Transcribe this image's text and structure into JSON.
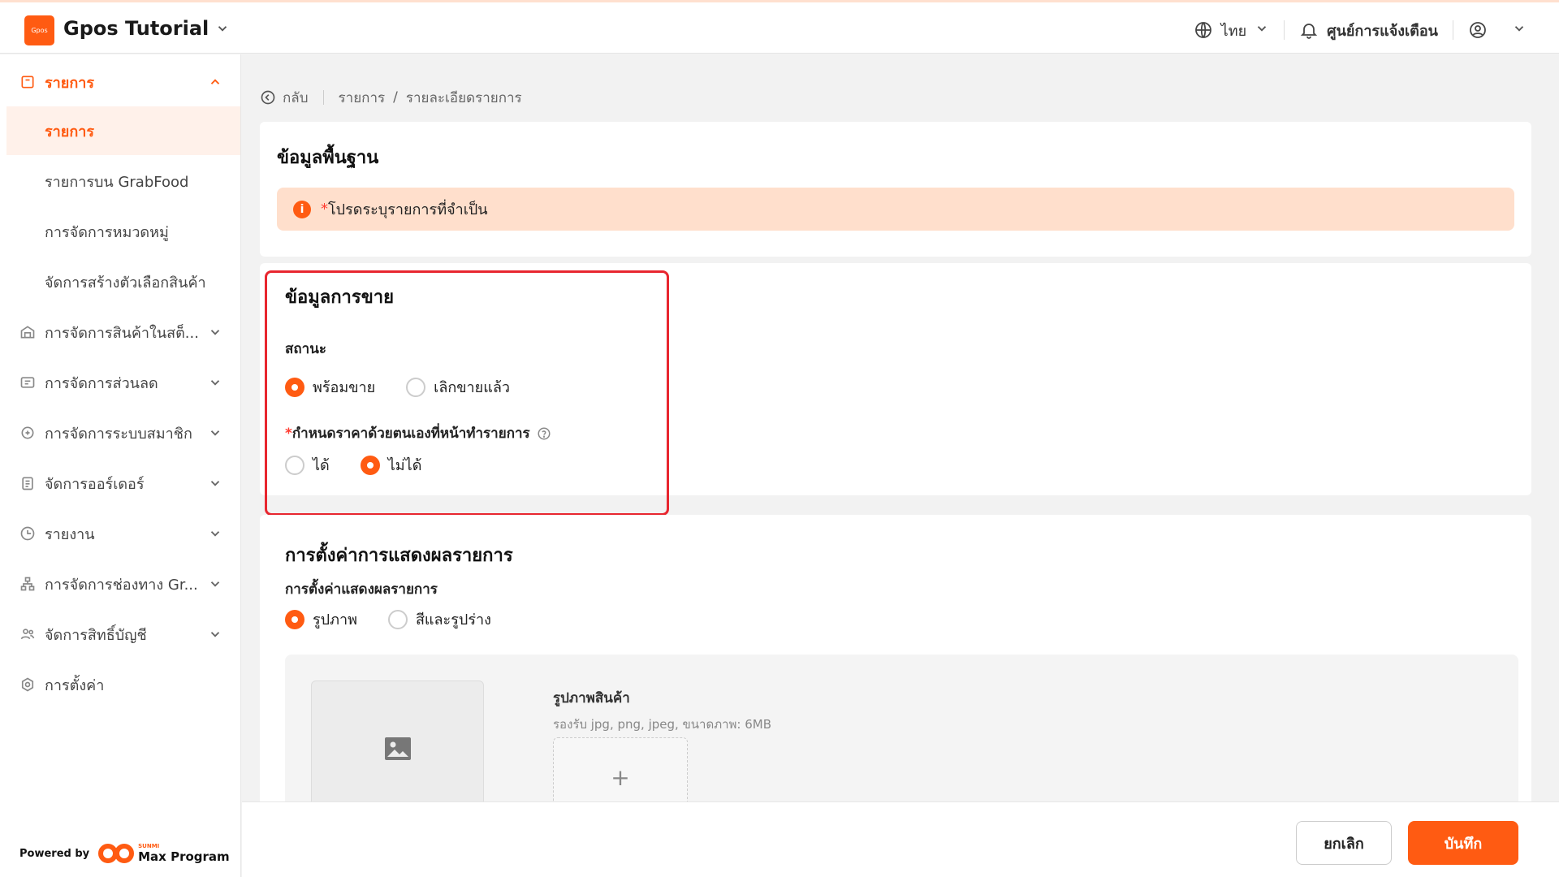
{
  "header": {
    "logo_text": "Gpos",
    "app_title": "Gpos Tutorial",
    "language": "ไทย",
    "notifications_label": "ศูนย์การแจ้งเตือน"
  },
  "sidebar": {
    "items": [
      {
        "label": "รายการ",
        "icon": "box-icon"
      },
      {
        "label": "รายการ"
      },
      {
        "label": "รายการบน GrabFood"
      },
      {
        "label": "การจัดการหมวดหมู่"
      },
      {
        "label": "จัดการสร้างตัวเลือกสินค้า"
      },
      {
        "label": "การจัดการสินค้าในสต็...",
        "icon": "warehouse-icon"
      },
      {
        "label": "การจัดการส่วนลด",
        "icon": "ticket-icon"
      },
      {
        "label": "การจัดการระบบสมาชิก",
        "icon": "member-icon"
      },
      {
        "label": "จัดการออร์เดอร์",
        "icon": "clipboard-icon"
      },
      {
        "label": "รายงาน",
        "icon": "clock-icon"
      },
      {
        "label": "การจัดการช่องทาง Gr...",
        "icon": "hierarchy-icon"
      },
      {
        "label": "จัดการสิทธิ์บัญชี",
        "icon": "users-icon"
      },
      {
        "label": "การตั้งค่า",
        "icon": "settings-icon"
      }
    ],
    "powered_by": "Powered by",
    "brand_small": "SUNMI",
    "brand_name": "Max Program"
  },
  "breadcrumb": {
    "back": "กลับ",
    "path1": "รายการ",
    "divider": "/",
    "path2": "รายละเอียดรายการ"
  },
  "basic_info": {
    "title": "ข้อมูลพื้นฐาน",
    "notice_star": "*",
    "notice_text": "โปรดระบุรายการที่จำเป็น"
  },
  "sales_info": {
    "title": "ข้อมูลการขาย",
    "status_label": "สถานะ",
    "status_options": [
      "พร้อมขาย",
      "เลิกขายแล้ว"
    ],
    "status_selected": "พร้อมขาย",
    "price_label_star": "*",
    "price_label": "กำหนดราคาด้วยตนเองที่หน้าทำรายการ",
    "price_options": [
      "ได้",
      "ไม่ได้"
    ],
    "price_selected": "ไม่ได้"
  },
  "display_settings": {
    "title": "การตั้งค่าการแสดงผลรายการ",
    "label": "การตั้งค่าแสดงผลรายการ",
    "options": [
      "รูปภาพ",
      "สีและรูปร่าง"
    ],
    "selected": "รูปภาพ",
    "image_label": "รูปภาพสินค้า",
    "image_hint": "รองรับ jpg, png, jpeg, ขนาดภาพ: 6MB",
    "upload_symbol": "+"
  },
  "footer": {
    "cancel": "ยกเลิก",
    "save": "บันทึก"
  },
  "colors": {
    "accent": "#ff5b12",
    "highlight": "#e8262f"
  }
}
